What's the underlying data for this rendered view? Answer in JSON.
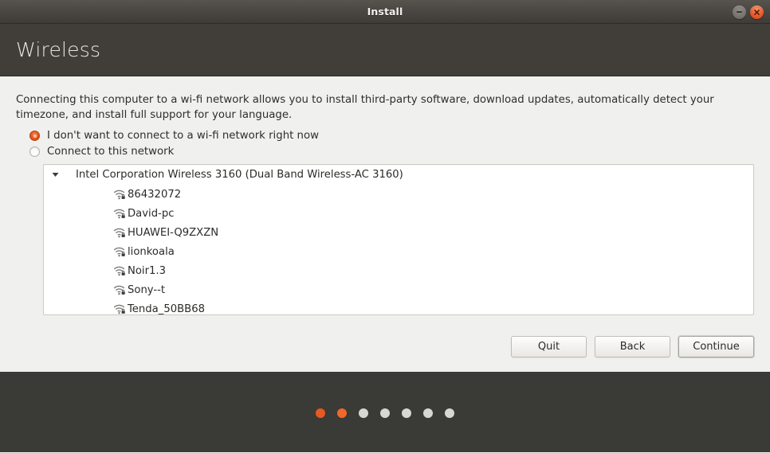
{
  "window": {
    "title": "Install",
    "controls": [
      {
        "name": "minimize-button",
        "icon": "minimize-icon"
      },
      {
        "name": "close-button",
        "icon": "close-icon"
      }
    ]
  },
  "header": {
    "title": "Wireless"
  },
  "main": {
    "intro": "Connecting this computer to a wi-fi network allows you to install third-party software, download updates, automatically detect your timezone, and install full support for your language.",
    "options": [
      {
        "label": "I don't want to connect to a wi-fi network right now",
        "selected": true
      },
      {
        "label": "Connect to this network",
        "selected": false
      }
    ],
    "adapter": {
      "name": "Intel Corporation Wireless 3160 (Dual Band Wireless-AC 3160)",
      "expanded": true,
      "disclosure_icon": "triangle-down-icon"
    },
    "networks": [
      {
        "ssid": "86432072",
        "icon": "wifi-secured-icon"
      },
      {
        "ssid": "David-pc",
        "icon": "wifi-secured-icon"
      },
      {
        "ssid": "HUAWEI-Q9ZXZN",
        "icon": "wifi-secured-icon"
      },
      {
        "ssid": "lionkoala",
        "icon": "wifi-secured-icon"
      },
      {
        "ssid": "Noir1.3",
        "icon": "wifi-secured-icon"
      },
      {
        "ssid": "Sony--t",
        "icon": "wifi-secured-icon"
      },
      {
        "ssid": "Tenda_50BB68",
        "icon": "wifi-secured-icon"
      }
    ]
  },
  "buttons": {
    "quit": "Quit",
    "back": "Back",
    "continue": "Continue"
  },
  "slideshow": {
    "dots": [
      {
        "state": "done"
      },
      {
        "state": "current"
      },
      {
        "state": "pending"
      },
      {
        "state": "pending"
      },
      {
        "state": "pending"
      },
      {
        "state": "pending"
      },
      {
        "state": "pending"
      }
    ]
  },
  "colors": {
    "accent": "#e8591f",
    "titlebar": "#4b4844",
    "header": "#413e3a",
    "content_bg": "#f0f0ee",
    "slideshow_bg": "#3a3a36"
  }
}
